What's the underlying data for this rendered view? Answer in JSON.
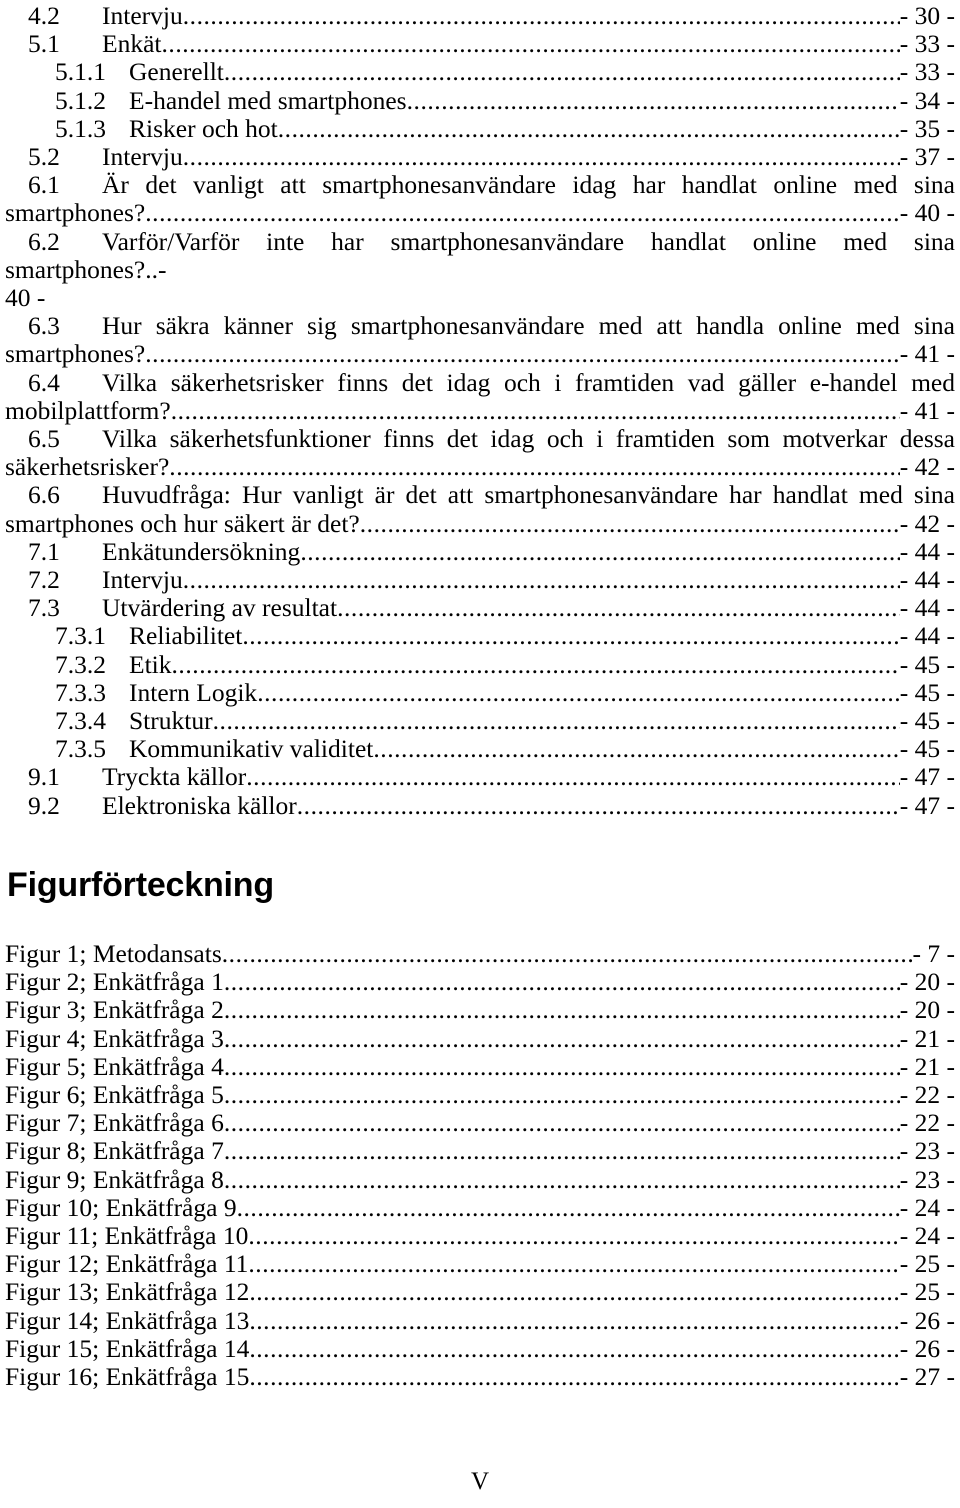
{
  "page": {
    "footer_page_number": "V",
    "background_color": "#ffffff",
    "text_color": "#000000"
  },
  "toc": {
    "entries": [
      {
        "number": "4.2",
        "level": 2,
        "title": "Intervju",
        "page": "- 30 -",
        "wraps": false
      },
      {
        "number": "5.1",
        "level": 2,
        "title": "Enkät",
        "page": "- 33 -",
        "wraps": false
      },
      {
        "number": "5.1.1",
        "level": 3,
        "title": "Generellt",
        "page": "- 33 -",
        "wraps": false
      },
      {
        "number": "5.1.2",
        "level": 3,
        "title": "E-handel med smartphones",
        "page": "- 34 -",
        "wraps": false
      },
      {
        "number": "5.1.3",
        "level": 3,
        "title": "Risker och hot",
        "page": "- 35 -",
        "wraps": false
      },
      {
        "number": "5.2",
        "level": 2,
        "title": "Intervju",
        "page": "- 37 -",
        "wraps": false
      },
      {
        "number": "6.1",
        "level": 2,
        "title": "Är det vanligt att smartphonesanvändare idag har handlat online med sina",
        "title_cont": "smartphones?",
        "page": "- 40 -",
        "wraps": true,
        "cont_has_leader": true
      },
      {
        "number": "6.2",
        "level": 2,
        "title": "Varför/Varför inte har smartphonesanvändare handlat online med sina smartphones?..-",
        "title_cont": "40 -",
        "page": "",
        "wraps": true,
        "cont_has_leader": false
      },
      {
        "number": "6.3",
        "level": 2,
        "title": "Hur säkra känner sig smartphonesanvändare med att handla online med sina",
        "title_cont": "smartphones?",
        "page": "- 41 -",
        "wraps": true,
        "cont_has_leader": true
      },
      {
        "number": "6.4",
        "level": 2,
        "title": "Vilka säkerhetsrisker finns det idag och i framtiden vad gäller e-handel med",
        "title_cont": "mobilplattform?",
        "page": "- 41 -",
        "wraps": true,
        "cont_has_leader": true
      },
      {
        "number": "6.5",
        "level": 2,
        "title": "Vilka säkerhetsfunktioner finns det idag och i framtiden som motverkar dessa",
        "title_cont": "säkerhetsrisker?",
        "page": "- 42 -",
        "wraps": true,
        "cont_has_leader": true
      },
      {
        "number": "6.6",
        "level": 2,
        "title": "Huvudfråga: Hur vanligt är det att smartphonesanvändare har handlat med sina",
        "title_cont": "smartphones och hur säkert är det?",
        "page": "- 42 -",
        "wraps": true,
        "cont_has_leader": true
      },
      {
        "number": "7.1",
        "level": 2,
        "title": "Enkätundersökning",
        "page": "- 44 -",
        "wraps": false
      },
      {
        "number": "7.2",
        "level": 2,
        "title": "Intervju",
        "page": "- 44 -",
        "wraps": false
      },
      {
        "number": "7.3",
        "level": 2,
        "title": "Utvärdering av resultat",
        "page": "- 44 -",
        "wraps": false
      },
      {
        "number": "7.3.1",
        "level": 3,
        "title": "Reliabilitet",
        "page": "- 44 -",
        "wraps": false
      },
      {
        "number": "7.3.2",
        "level": 3,
        "title": "Etik",
        "page": "- 45 -",
        "wraps": false
      },
      {
        "number": "7.3.3",
        "level": 3,
        "title": "Intern Logik",
        "page": "- 45 -",
        "wraps": false
      },
      {
        "number": "7.3.4",
        "level": 3,
        "title": "Struktur",
        "page": "- 45 -",
        "wraps": false
      },
      {
        "number": "7.3.5",
        "level": 3,
        "title": "Kommunikativ validitet",
        "page": "- 45 -",
        "wraps": false
      },
      {
        "number": "9.1",
        "level": 2,
        "title": "Tryckta källor",
        "page": "- 47 -",
        "wraps": false
      },
      {
        "number": "9.2",
        "level": 2,
        "title": "Elektroniska källor",
        "page": "- 47 -",
        "wraps": false
      }
    ]
  },
  "figures": {
    "heading": "Figurförteckning",
    "entries": [
      {
        "title": "Figur 1; Metodansats",
        "page": "- 7 -"
      },
      {
        "title": "Figur 2; Enkätfråga 1",
        "page": "- 20 -"
      },
      {
        "title": "Figur 3; Enkätfråga 2",
        "page": "- 20 -"
      },
      {
        "title": "Figur 4; Enkätfråga 3",
        "page": "- 21 -"
      },
      {
        "title": "Figur 5; Enkätfråga 4",
        "page": "- 21 -"
      },
      {
        "title": "Figur 6; Enkätfråga 5",
        "page": "- 22 -"
      },
      {
        "title": "Figur 7; Enkätfråga 6",
        "page": "- 22 -"
      },
      {
        "title": "Figur 8; Enkätfråga 7",
        "page": "- 23 -"
      },
      {
        "title": "Figur 9; Enkätfråga 8",
        "page": "- 23 -"
      },
      {
        "title": "Figur 10; Enkätfråga 9",
        "page": "- 24 -"
      },
      {
        "title": "Figur 11; Enkätfråga 10",
        "page": "- 24 -"
      },
      {
        "title": "Figur 12; Enkätfråga 11",
        "page": "- 25 -"
      },
      {
        "title": "Figur 13; Enkätfråga 12",
        "page": "- 25 -"
      },
      {
        "title": "Figur 14; Enkätfråga 13",
        "page": "- 26 -"
      },
      {
        "title": "Figur 15; Enkätfråga 14",
        "page": "- 26 -"
      },
      {
        "title": "Figur 16; Enkätfråga 15",
        "page": "- 27 -"
      }
    ]
  }
}
